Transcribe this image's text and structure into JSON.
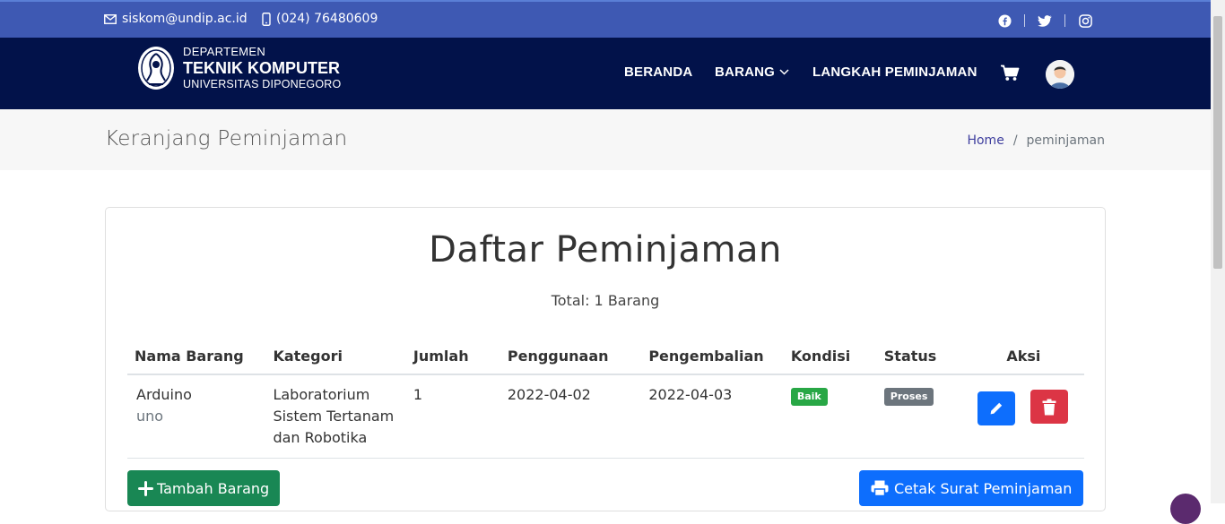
{
  "topbar": {
    "email": "siskom@undip.ac.id",
    "phone": "(024) 76480609",
    "social": [
      "facebook-icon",
      "twitter-icon",
      "instagram-icon"
    ]
  },
  "brand": {
    "line1": "DEPARTEMEN",
    "line2": "TEKNIK KOMPUTER",
    "line3": "UNIVERSITAS DIPONEGORO"
  },
  "nav": {
    "items": [
      "BERANDA",
      "BARANG",
      "LANGKAH PEMINJAMAN"
    ]
  },
  "page": {
    "title": "Keranjang Peminjaman",
    "breadcrumb": [
      "Home",
      "peminjaman"
    ]
  },
  "card": {
    "heading": "Daftar Peminjaman",
    "total": "Total: 1 Barang",
    "columns": [
      "Nama Barang",
      "Kategori",
      "Jumlah",
      "Penggunaan",
      "Pengembalian",
      "Kondisi",
      "Status",
      "Aksi"
    ],
    "rows": [
      {
        "name": "Arduino",
        "sub": "uno",
        "kategori": "Laboratorium Sistem Tertanam dan Robotika",
        "jumlah": "1",
        "penggunaan": "2022-04-02",
        "pengembalian": "2022-04-03",
        "kondisi": "Baik",
        "status": "Proses"
      }
    ],
    "add_label": "Tambah Barang",
    "print_label": "Cetak Surat Peminjaman"
  },
  "colors": {
    "topbar": "#3e59b3",
    "navbar": "#02124a",
    "success": "#198754",
    "primary": "#0d6efd",
    "danger": "#dc3545"
  }
}
